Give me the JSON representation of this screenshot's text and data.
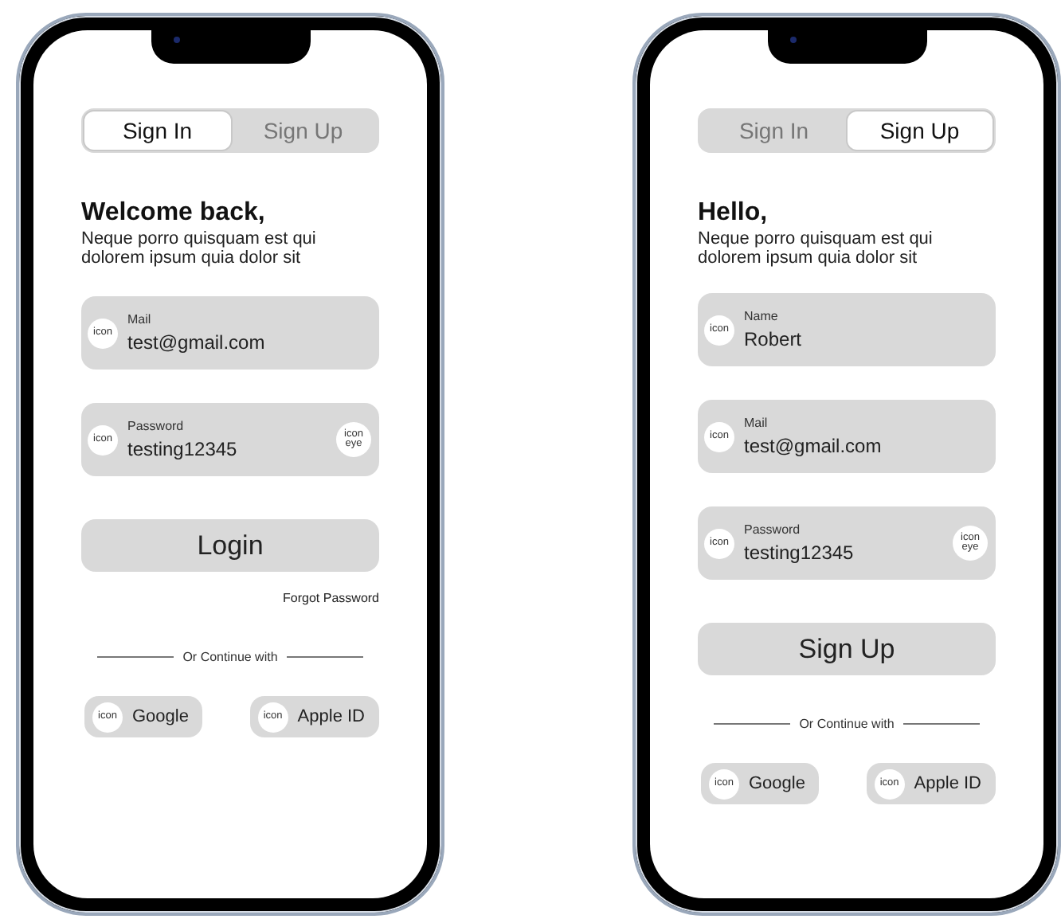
{
  "phones": [
    {
      "tabs": [
        {
          "label": "Sign In",
          "selected": true
        },
        {
          "label": "Sign Up",
          "selected": false
        }
      ],
      "heading": "Welcome back,",
      "subtitle": "Neque porro quisquam est qui dolorem ipsum quia dolor sit",
      "fields": [
        {
          "label": "Mail",
          "value": "test@gmail.com",
          "icon_text": "icon"
        },
        {
          "label": "Password",
          "value": "testing12345",
          "icon_text": "icon",
          "trailing_icon_text": "icon eye"
        }
      ],
      "primary_button": "Login",
      "forgot_link": "Forgot Password",
      "divider_text": "Or Continue with",
      "social_buttons": [
        {
          "label": "Google",
          "icon_text": "icon"
        },
        {
          "label": "Apple ID",
          "icon_text": "icon"
        }
      ]
    },
    {
      "tabs": [
        {
          "label": "Sign In",
          "selected": false
        },
        {
          "label": "Sign Up",
          "selected": true
        }
      ],
      "heading": "Hello,",
      "subtitle": "Neque porro quisquam est qui dolorem ipsum quia dolor sit",
      "fields": [
        {
          "label": "Name",
          "value": "Robert",
          "icon_text": "icon"
        },
        {
          "label": "Mail",
          "value": "test@gmail.com",
          "icon_text": "icon"
        },
        {
          "label": "Password",
          "value": "testing12345",
          "icon_text": "icon",
          "trailing_icon_text": "icon eye"
        }
      ],
      "primary_button": "Sign Up",
      "divider_text": "Or Continue with",
      "social_buttons": [
        {
          "label": "Google",
          "icon_text": "icon"
        },
        {
          "label": "Apple ID",
          "icon_text": "icon"
        }
      ]
    }
  ]
}
